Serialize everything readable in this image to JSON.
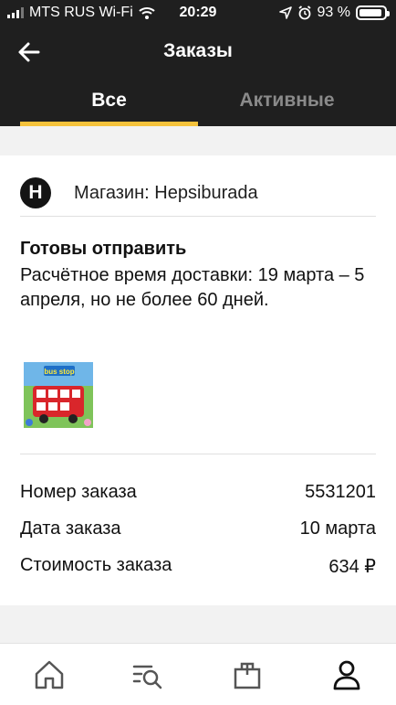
{
  "status_bar": {
    "carrier": "MTS RUS Wi-Fi",
    "time": "20:29",
    "battery": "93 %",
    "battery_level": 0.93
  },
  "header": {
    "title": "Заказы"
  },
  "tabs": [
    {
      "label": "Все",
      "selected": true
    },
    {
      "label": "Активные",
      "selected": false
    }
  ],
  "order": {
    "store_logo_letter": "H",
    "store_label": "Магазин: Hepsiburada",
    "status_title": "Готовы отправить",
    "delivery_text": "Расчётное время доставки: 19 марта – 5 апреля, но не более 60 дней.",
    "product_image_text": "bus stop",
    "details": [
      {
        "label": "Номер заказа",
        "value": "5531201"
      },
      {
        "label": "Дата заказа",
        "value": "10 марта"
      },
      {
        "label": "Стоимость заказа",
        "value": "634 ₽"
      }
    ]
  },
  "bottom_nav": {
    "icons": [
      "home-icon",
      "search-list-icon",
      "bag-icon",
      "profile-icon"
    ]
  },
  "colors": {
    "header_bg": "#1f1f1f",
    "accent": "#f5c23b",
    "inactive_tab": "#8a8a8a",
    "page_bg": "#f2f2f2"
  }
}
